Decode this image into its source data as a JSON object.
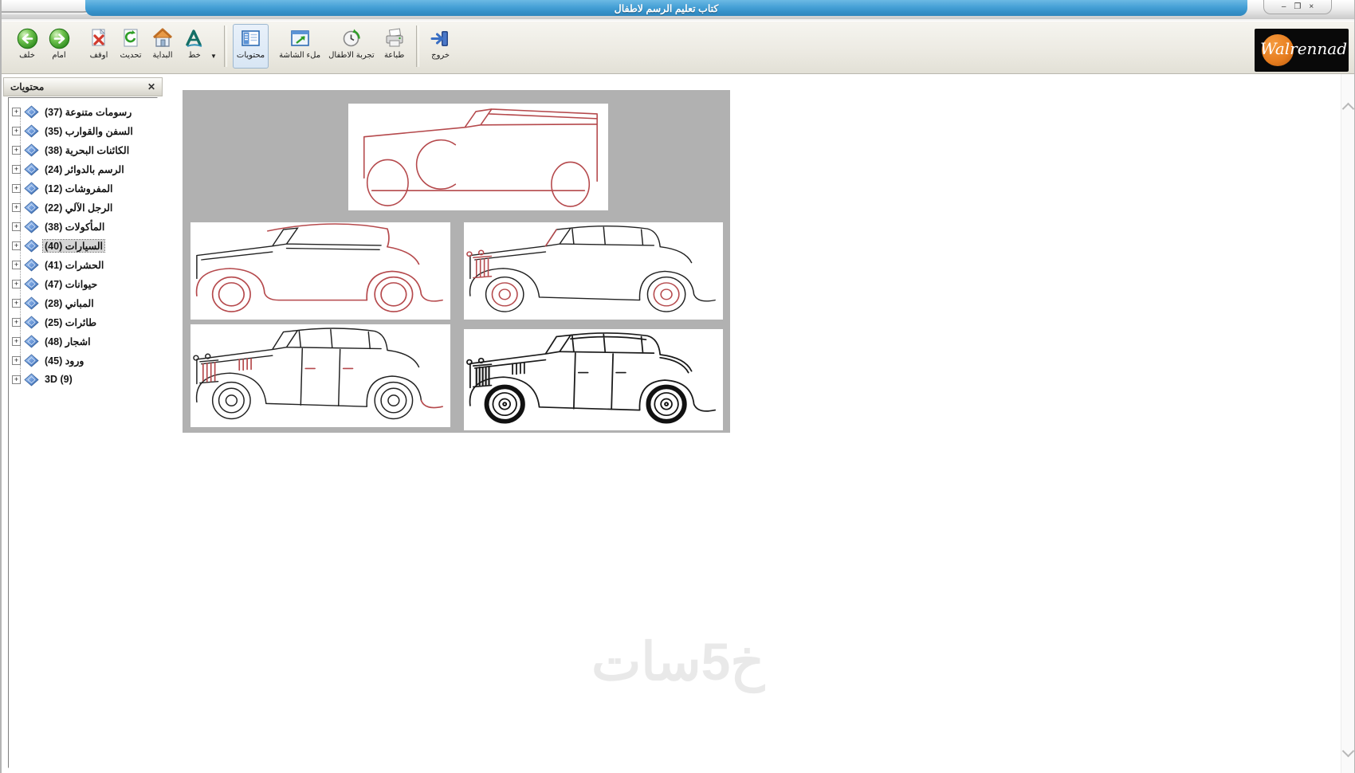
{
  "window": {
    "title": "كتاب تعليم الرسم لاطفال",
    "controls": {
      "minimize": "–",
      "restore": "❐",
      "close": "×"
    }
  },
  "logo": {
    "text": "Walrennad"
  },
  "toolbar": {
    "buttons": [
      {
        "id": "back",
        "label": "خلف"
      },
      {
        "id": "forward",
        "label": "امام"
      },
      {
        "id": "stop",
        "label": "اوقف"
      },
      {
        "id": "refresh",
        "label": "تحديث"
      },
      {
        "id": "home",
        "label": "البداية"
      },
      {
        "id": "font",
        "label": "خط"
      },
      {
        "id": "contents",
        "label": "محتويات",
        "pressed": true
      },
      {
        "id": "fullscreen",
        "label": "ملء الشاشة"
      },
      {
        "id": "kids-timer",
        "label": "تجربة الاطفال"
      },
      {
        "id": "print",
        "label": "طباعة"
      },
      {
        "id": "exit",
        "label": "خروج"
      }
    ]
  },
  "sidebar": {
    "header": "محتويات",
    "items": [
      {
        "label": "رسومات متنوعة (37)"
      },
      {
        "label": "السفن والقوارب (35)"
      },
      {
        "label": "الكائنات البحرية (38)"
      },
      {
        "label": "الرسم بالدوائر (24)"
      },
      {
        "label": "المفروشات (12)"
      },
      {
        "label": "الرجل الآلي (22)"
      },
      {
        "label": "المأكولات (38)"
      },
      {
        "label": "السيارات (40)",
        "selected": true
      },
      {
        "label": "الحشرات (41)"
      },
      {
        "label": "حيوانات (47)"
      },
      {
        "label": "المباني (28)"
      },
      {
        "label": "طائرات (25)"
      },
      {
        "label": "اشجار (48)"
      },
      {
        "label": "ورود (45)"
      },
      {
        "label": "3D (9)"
      }
    ]
  },
  "content": {
    "drawings": [
      "vintage-car-step1-red-outline",
      "vintage-car-step2-red-fenders-wheels",
      "vintage-car-step3-red-wheel-details",
      "vintage-car-step4-red-door-details",
      "vintage-car-step5-finished-black"
    ]
  },
  "watermark": "خ5سات",
  "glyphs": {
    "caret": "▼",
    "close_panel": "✕",
    "plus": "+"
  },
  "colors": {
    "titlebar_blue": "#3f97cf",
    "sketch_red": "#b5494c",
    "sketch_black": "#222222",
    "panel_gray": "#b1b1b1",
    "accent_green": "#3fa32f",
    "logo_orange": "#e67c1e"
  }
}
